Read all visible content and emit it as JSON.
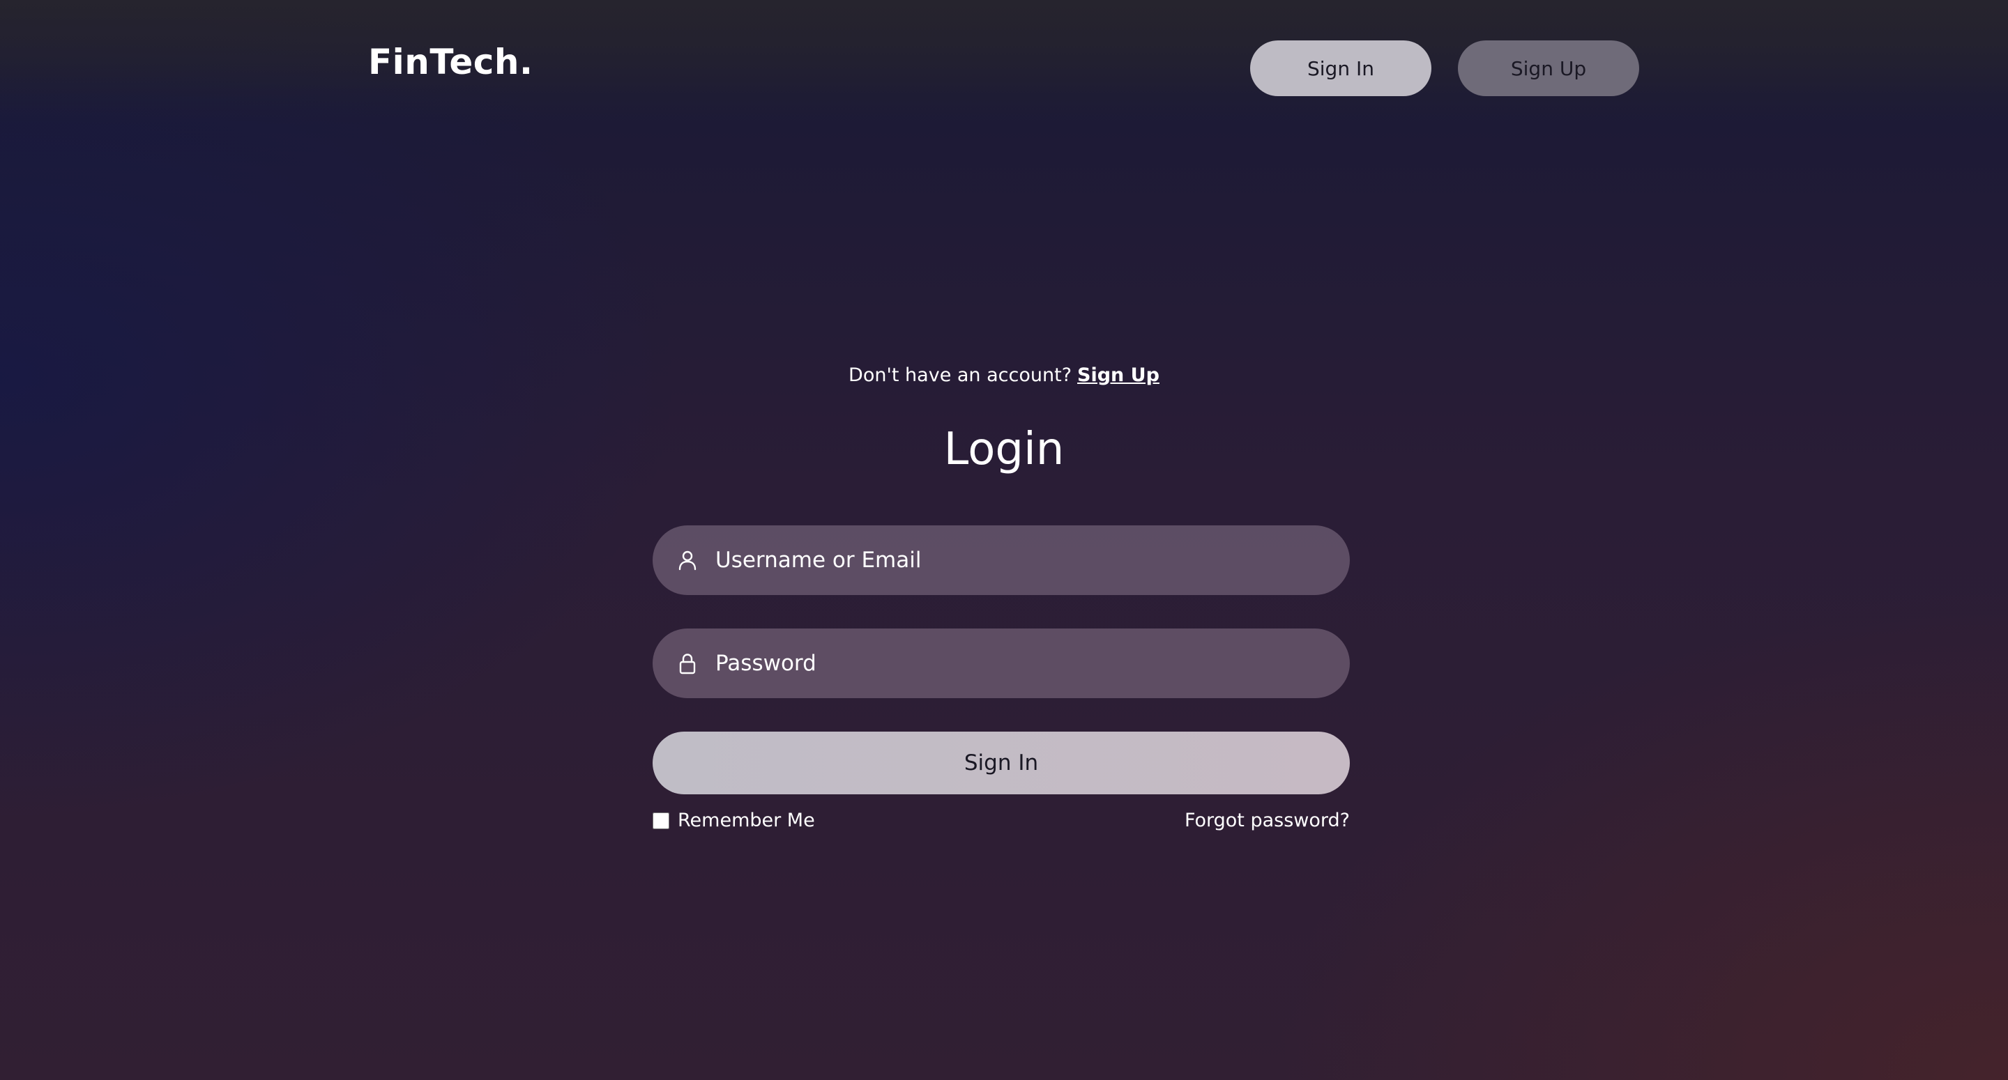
{
  "header": {
    "brand": "FinTech.",
    "sign_in_label": "Sign In",
    "sign_up_label": "Sign Up"
  },
  "login": {
    "prompt_text": "Don't have an account?",
    "prompt_link": "Sign Up",
    "title": "Login",
    "username": {
      "placeholder": "Username or Email",
      "value": "",
      "icon": "user-icon"
    },
    "password": {
      "placeholder": "Password",
      "value": "",
      "icon": "lock-icon"
    },
    "submit_label": "Sign In",
    "remember_label": "Remember Me",
    "remember_checked": false,
    "forgot_label": "Forgot password?"
  },
  "colors": {
    "nav_sign_in_bg": "#bebbc4",
    "nav_sign_up_bg": "#6f6b79",
    "field_bg": "#5e5163",
    "text": "#ffffff"
  }
}
